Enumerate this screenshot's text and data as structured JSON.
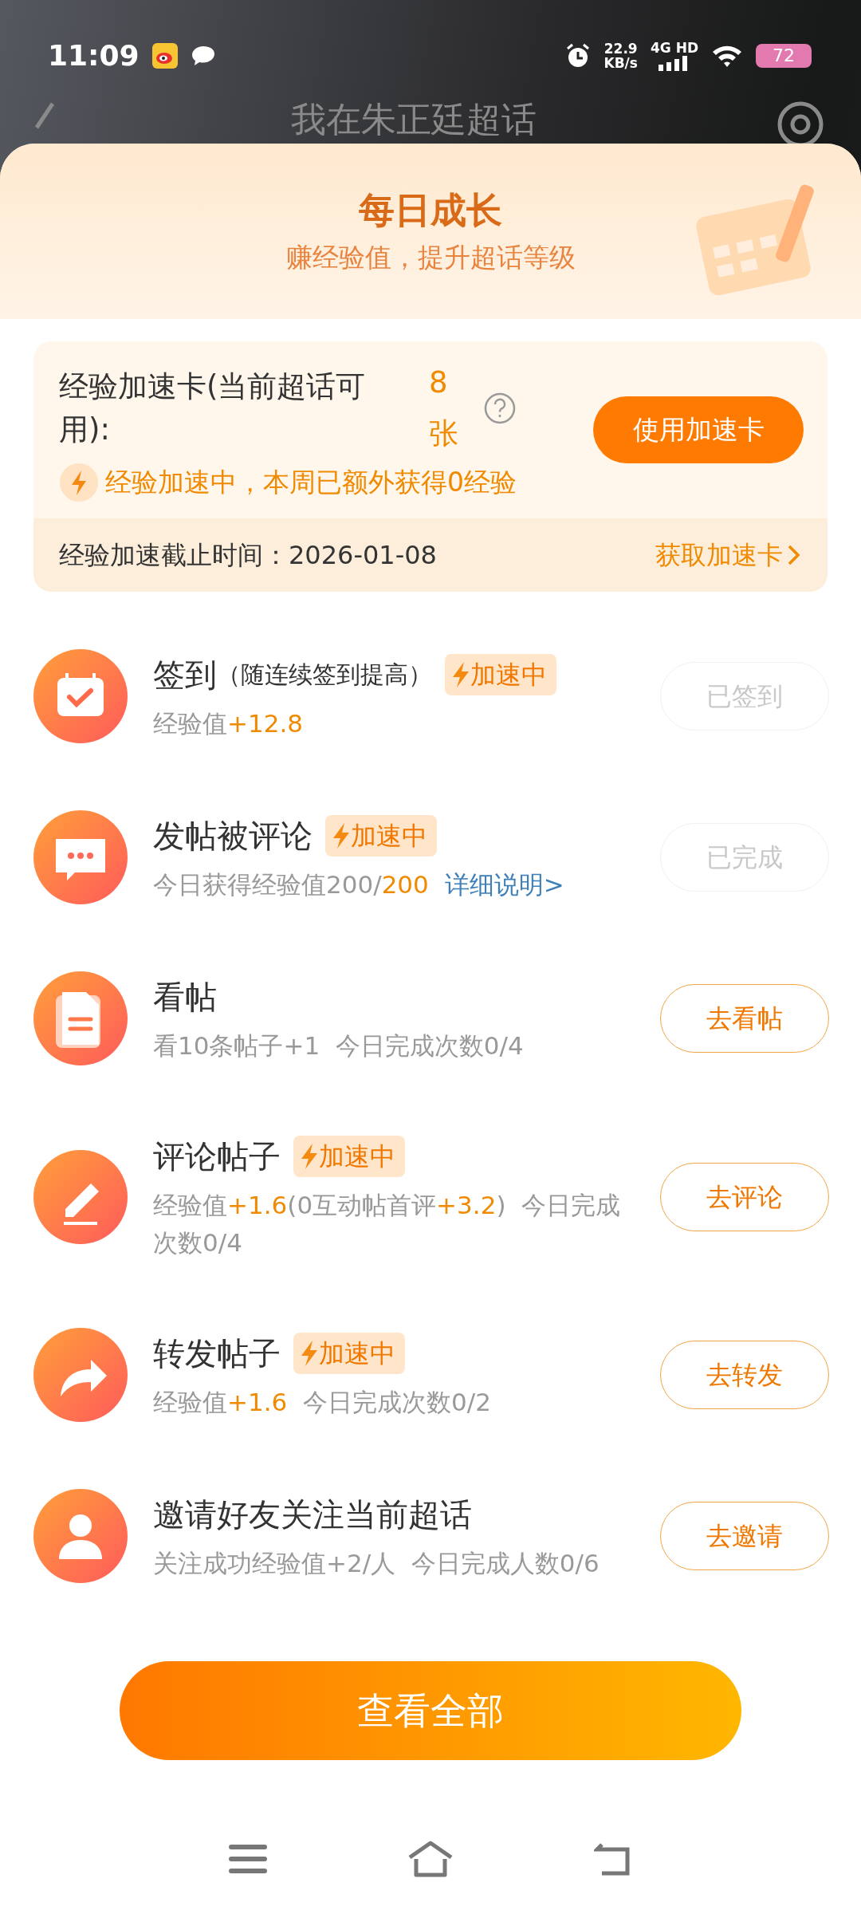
{
  "status_bar": {
    "time": "11:09",
    "speed": "22.9",
    "speed_unit": "KB/s",
    "network": "4G HD",
    "battery": "72"
  },
  "page_header": {
    "title": "我在朱正廷超话"
  },
  "sheet": {
    "title": "每日成长",
    "subtitle": "赚经验值，提升超话等级"
  },
  "boost_card": {
    "label": "经验加速卡(当前超话可用):",
    "count": "8张",
    "use_button": "使用加速卡",
    "status": "经验加速中，本周已额外获得0经验",
    "deadline": "经验加速截止时间：2026-01-08",
    "get_link": "获取加速卡"
  },
  "tasks": [
    {
      "kind": "calendar",
      "title": "签到",
      "note": "（随连续签到提高）",
      "boosted": true,
      "badge": "加速中",
      "detail": [
        {
          "text": "经验值",
          "accent": false
        },
        {
          "text": "+12.8",
          "accent": true
        }
      ],
      "button": {
        "label": "已签到",
        "done": true
      }
    },
    {
      "kind": "chat",
      "title": "发帖被评论",
      "boosted": true,
      "badge": "加速中",
      "detail": [
        {
          "text": "今日获得经验值200/",
          "accent": false
        },
        {
          "text": "200",
          "accent": true
        }
      ],
      "link": "详细说明>",
      "button": {
        "label": "已完成",
        "done": true
      }
    },
    {
      "kind": "document",
      "title": "看帖",
      "boosted": false,
      "detail": [
        {
          "text": "看10条帖子+1  今日完成次数0/4",
          "accent": false
        }
      ],
      "button": {
        "label": "去看帖",
        "done": false
      }
    },
    {
      "kind": "pencil",
      "title": "评论帖子",
      "boosted": true,
      "badge": "加速中",
      "detail": [
        {
          "text": "经验值",
          "accent": false
        },
        {
          "text": "+1.6",
          "accent": true
        },
        {
          "text": "(0互动帖首评",
          "accent": false
        },
        {
          "text": "+3.2",
          "accent": true
        },
        {
          "text": ")  今日完成次数0/4",
          "accent": false
        }
      ],
      "button": {
        "label": "去评论",
        "done": false
      }
    },
    {
      "kind": "share",
      "title": "转发帖子",
      "boosted": true,
      "badge": "加速中",
      "detail": [
        {
          "text": "经验值",
          "accent": false
        },
        {
          "text": "+1.6",
          "accent": true
        },
        {
          "text": "  今日完成次数0/2",
          "accent": false
        }
      ],
      "button": {
        "label": "去转发",
        "done": false
      }
    },
    {
      "kind": "person",
      "title": "邀请好友关注当前超话",
      "boosted": false,
      "detail": [
        {
          "text": "关注成功经验值+2/人  今日完成人数0/6",
          "accent": false
        }
      ],
      "button": {
        "label": "去邀请",
        "done": false
      }
    }
  ],
  "bottom_button": "查看全部"
}
